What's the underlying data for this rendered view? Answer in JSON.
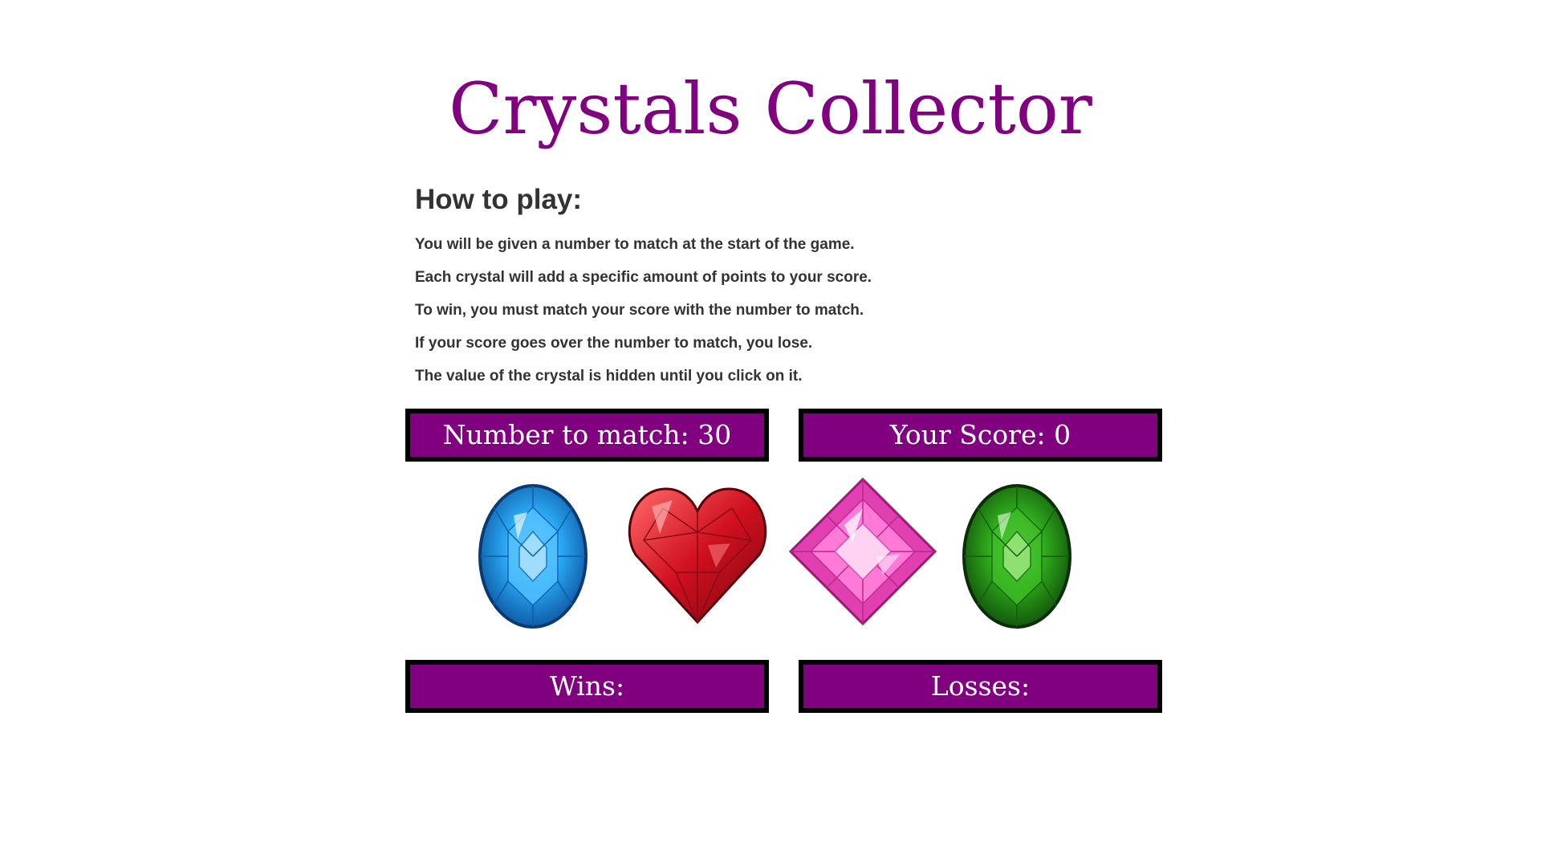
{
  "title": "Crystals Collector",
  "instructions": {
    "heading": "How to play:",
    "lines": [
      "You will be given a number to match at the start of the game.",
      "Each crystal will add a specific amount of points to your score.",
      "To win, you must match your score with the number to match.",
      "If your score goes over the number to match, you lose.",
      "The value of the crystal is hidden until you click on it."
    ]
  },
  "scoreboard": {
    "target_label": "Number to match: 30",
    "score_label": "Your Score: 0",
    "wins_label": "Wins:",
    "losses_label": "Losses:"
  },
  "crystals": [
    {
      "name": "blue-oval-crystal",
      "color": "#1a8fe0"
    },
    {
      "name": "red-heart-crystal",
      "color": "#c8141e"
    },
    {
      "name": "pink-square-crystal",
      "color": "#f05ac8"
    },
    {
      "name": "green-oval-crystal",
      "color": "#28a018"
    }
  ],
  "colors": {
    "accent": "#800080",
    "panel_border": "#000000",
    "panel_text": "#ffffff",
    "body_text": "#333333"
  }
}
